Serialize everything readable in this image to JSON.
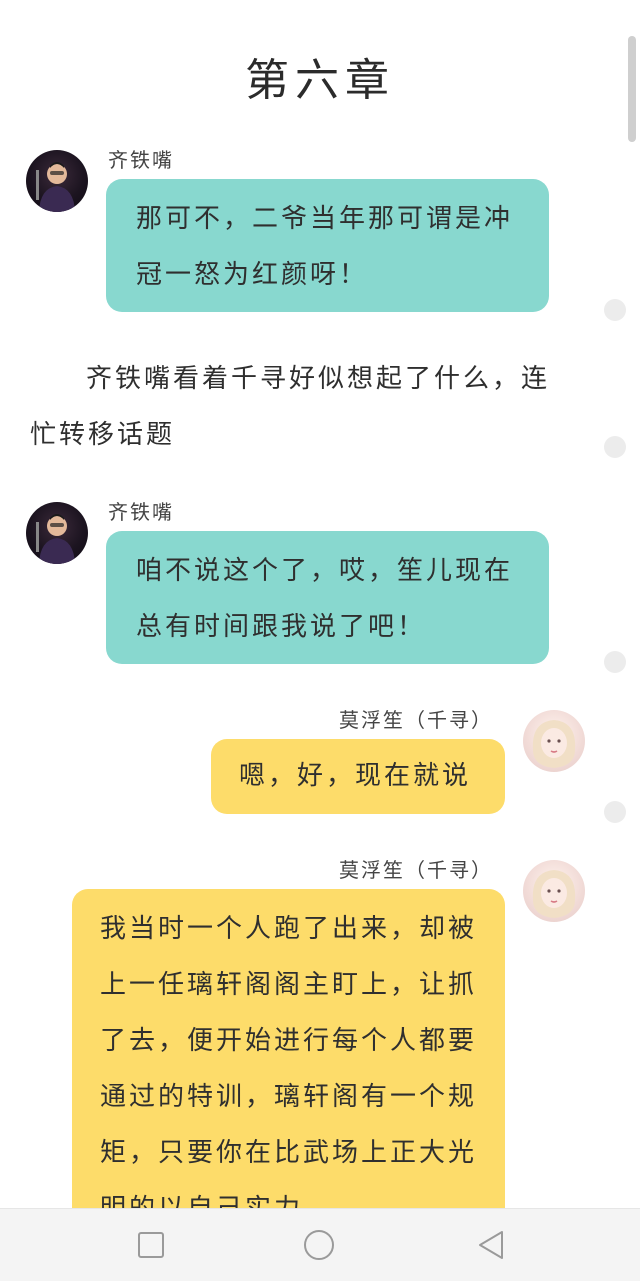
{
  "chapter_title": "第六章",
  "messages": [
    {
      "speaker": "齐铁嘴",
      "text": "那可不，二爷当年那可谓是冲冠一怒为红颜呀！"
    },
    {
      "narration": "齐铁嘴看着千寻好似想起了什么，连忙转移话题"
    },
    {
      "speaker": "齐铁嘴",
      "text": "咱不说这个了，哎，笙儿现在总有时间跟我说了吧！"
    },
    {
      "speaker": "莫浮笙（千寻）",
      "text": "嗯，好，现在就说"
    },
    {
      "speaker": "莫浮笙（千寻）",
      "text": "我当时一个人跑了出来，却被上一任璃轩阁阁主盯上，让抓了去，便开始进行每个人都要通过的特训，璃轩阁有一个规矩，只要你在比武场上正大光明的以自己实力"
    }
  ],
  "icons": {
    "square": "recent-apps-icon",
    "circle": "home-icon",
    "triangle": "back-icon"
  },
  "colors": {
    "teal_bubble": "#88d8cf",
    "yellow_bubble": "#fddc6a"
  }
}
